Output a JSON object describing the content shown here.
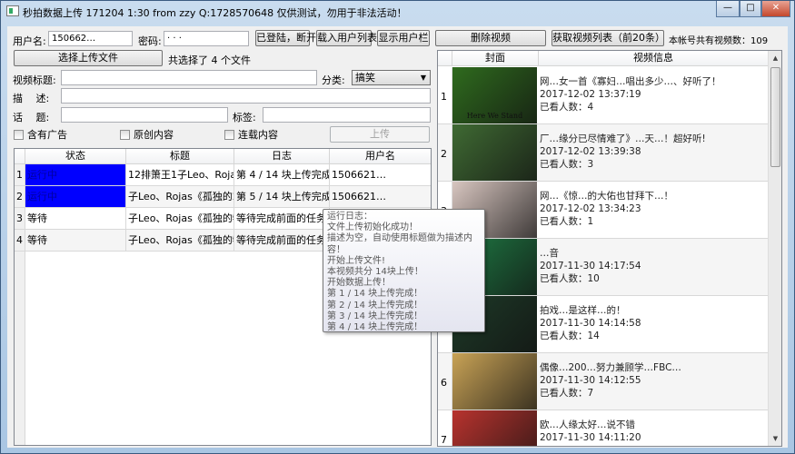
{
  "window": {
    "title": "秒拍数据上传 171204 1:30 from zzy Q:1728570648 仅供测试，勿用于非法活动！",
    "controls": [
      "—",
      "□",
      "✕"
    ]
  },
  "login": {
    "username_label": "用户名:",
    "username_value": "150662…",
    "password_label": "密码:",
    "password_value": "· · ·",
    "disconnect_btn": "已登陆，断开",
    "load_users_btn": "载入用户列表",
    "show_users_btn": "显示用户栏"
  },
  "file": {
    "select_btn": "选择上传文件",
    "selected_text": "共选择了 4 个文件"
  },
  "form": {
    "title_label": "视频标题:",
    "title_value": "",
    "category_label": "分类:",
    "category_value": "搞笑",
    "desc_label": "描　 述:",
    "desc_value": "",
    "topic_label": "话　 题:",
    "topic_value": "",
    "tags_label": "标签:",
    "tags_value": "",
    "checkboxes": [
      {
        "label": "含有广告",
        "checked": false
      },
      {
        "label": "原创内容",
        "checked": false
      },
      {
        "label": "连载内容",
        "checked": false
      }
    ],
    "upload_btn": "上传"
  },
  "tasks": {
    "columns": [
      "状态",
      "标题",
      "日志",
      "用户名"
    ],
    "rows": [
      {
        "n": "1",
        "status": "运行中",
        "title": "12排箫王1子Leo、Roja...",
        "log": "第 4 / 14 块上传完成！",
        "user": "1506621…",
        "selected": true
      },
      {
        "n": "2",
        "status": "运行中",
        "title": "子Leo、Rojas《孤独的2...",
        "log": "第 5 / 14 块上传完成！",
        "user": "1506621…",
        "selected": true
      },
      {
        "n": "3",
        "status": "等待",
        "title": "子Leo、Rojas《孤独的牧...",
        "log": "等待完成前面的任务",
        "user": "",
        "selected": false
      },
      {
        "n": "4",
        "status": "等待",
        "title": "子Leo、Rojas《孤独的牧...",
        "log": "等待完成前面的任务",
        "user": "",
        "selected": false
      }
    ]
  },
  "tooltip": {
    "lines": [
      "运行日志：",
      "文件上传初始化成功！",
      "描述为空，自动使用标题做为描述内容！",
      "开始上传文件!",
      "本视频共分 14块上传！",
      "开始数据上传！",
      "第 1 / 14 块上传完成！",
      "第 2 / 14 块上传完成！",
      "第 3 / 14 块上传完成！",
      "第 4 / 14 块上传完成！"
    ]
  },
  "videos": {
    "delete_btn": "删除视频",
    "fetch_btn": "获取视频列表（前20条）",
    "count_text": "本帐号共有视频数：109",
    "columns": [
      "封面",
      "视频信息"
    ],
    "thumb_caption": "Here We Stand",
    "rows": [
      {
        "n": "1",
        "title": "网…女一首《寡妇…唱出多少…、好听了！",
        "time": "2017-12-02 13:37:19",
        "views": "已看人数：4",
        "color": "#2f6b1e"
      },
      {
        "n": "2",
        "title": "厂…缘分已尽情难了》…天…！超好听!",
        "time": "2017-12-02 13:39:38",
        "views": "已看人数：3",
        "color": "#3f6a33"
      },
      {
        "n": "3",
        "title": "网…《惊…的大佑也甘拜下…！",
        "time": "2017-12-02 13:34:23",
        "views": "已看人数：1",
        "color": "#d8c6c0"
      },
      {
        "n": "4",
        "title": "…音",
        "time": "2017-11-30 14:17:54",
        "views": "已看人数：10",
        "color": "#1f7a44"
      },
      {
        "n": "5",
        "title": "拍戏…是这样…的！",
        "time": "2017-11-30 14:14:58",
        "views": "已看人数：14",
        "color": "#1e3a28"
      },
      {
        "n": "6",
        "title": "偶像…200…努力兼顾学…FBC…",
        "time": "2017-11-30 14:12:55",
        "views": "已看人数：7",
        "color": "#c9a356"
      },
      {
        "n": "7",
        "title": "欧…人缘太好…说不错",
        "time": "2017-11-30 14:11:20",
        "views": "",
        "color": "#b8332e"
      }
    ]
  }
}
